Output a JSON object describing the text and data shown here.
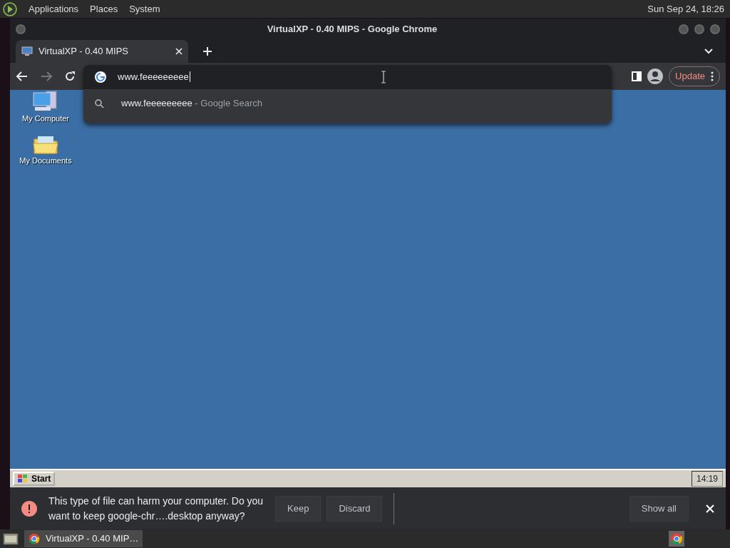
{
  "top_panel": {
    "menus": [
      "Applications",
      "Places",
      "System"
    ],
    "clock": "Sun Sep 24, 18:26"
  },
  "window": {
    "title": "VirtualXP - 0.40 MIPS - Google Chrome"
  },
  "tabs": [
    {
      "label": "VirtualXP - 0.40 MIPS",
      "selected": true
    }
  ],
  "omnibox": {
    "value": "www.feeeeeeeee",
    "suggestions": [
      {
        "text": "www.feeeeeeeee",
        "suffix": "- Google Search"
      }
    ]
  },
  "toolbar": {
    "update_button": "Update"
  },
  "desktop_icons": [
    {
      "label": "My Computer",
      "kind": "computer"
    },
    {
      "label": "My Documents",
      "kind": "documents"
    }
  ],
  "xp_taskbar": {
    "start": "Start",
    "clock": "14:19"
  },
  "download_bar": {
    "message": "This type of file can harm your computer. Do you want to keep google-chr….desktop anyway?",
    "buttons": [
      "Keep",
      "Discard"
    ],
    "show_all": "Show all"
  },
  "bottom_panel": {
    "tasks": [
      {
        "label": "VirtualXP - 0.40 MIP…",
        "selected": true
      }
    ]
  }
}
